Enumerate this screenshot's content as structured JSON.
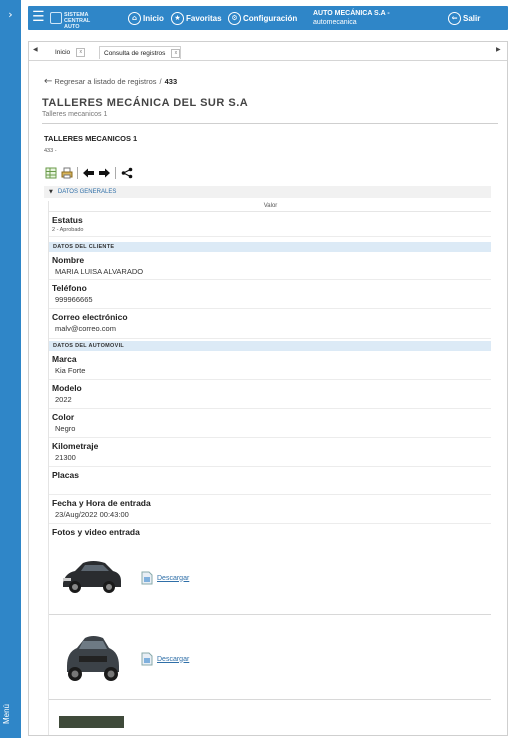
{
  "rail": {
    "toggle": "›",
    "label": "Menú"
  },
  "topbar": {
    "menu_icon": "☰",
    "logo_text_line1": "SISTEMA",
    "logo_text_line2": "CENTRAL AUTO",
    "nav": [
      {
        "label": "Inicio",
        "icon": "home-icon",
        "glyph": "⌂"
      },
      {
        "label": "Favoritas",
        "icon": "star-icon",
        "glyph": "★"
      },
      {
        "label": "Configuración",
        "icon": "gear-icon",
        "glyph": "⚙"
      }
    ],
    "company_name": "AUTO MECÁNICA S.A -",
    "company_sub": "automecanica",
    "logout_label": "Salir",
    "logout_glyph": "⇐"
  },
  "tabs": [
    {
      "label": "Inicio",
      "close": "x"
    },
    {
      "label": "Consulta de registros",
      "close": "x"
    }
  ],
  "breadcrumb": {
    "back_label": "Regresar a listado de registros",
    "separator": "/",
    "record_id": "433"
  },
  "page": {
    "title": "TALLERES MECÁNICA DEL SUR S.A",
    "subtitle": "Talleres mecanicos 1"
  },
  "record": {
    "title": "TALLERES MECANICOS 1",
    "id_line": "433 -"
  },
  "section": {
    "caret": "▼",
    "title": "DATOS GENERALES",
    "column_header": "Valor"
  },
  "fields": {
    "estatus": {
      "label": "Estatus",
      "value": "2 - Aprobado"
    },
    "group_cliente": "DATOS DEL CLIENTE",
    "nombre": {
      "label": "Nombre",
      "value": "MARIA LUISA ALVARADO"
    },
    "telefono": {
      "label": "Teléfono",
      "value": "999966665"
    },
    "correo": {
      "label": "Correo electrónico",
      "value": "malv@correo.com"
    },
    "group_auto": "DATOS DEL AUTOMOVIL",
    "marca": {
      "label": "Marca",
      "value": "Kia Forte"
    },
    "modelo": {
      "label": "Modelo",
      "value": "2022"
    },
    "color": {
      "label": "Color",
      "value": "Negro"
    },
    "kilometraje": {
      "label": "Kilometraje",
      "value": "21300"
    },
    "placas": {
      "label": "Placas",
      "value": ""
    },
    "fecha": {
      "label": "Fecha y Hora de entrada",
      "value": "23/Aug/2022 00:43:00"
    },
    "fotos": {
      "label": "Fotos y video entrada"
    }
  },
  "photos": [
    {
      "download_label": "Descargar"
    },
    {
      "download_label": "Descargar"
    }
  ]
}
